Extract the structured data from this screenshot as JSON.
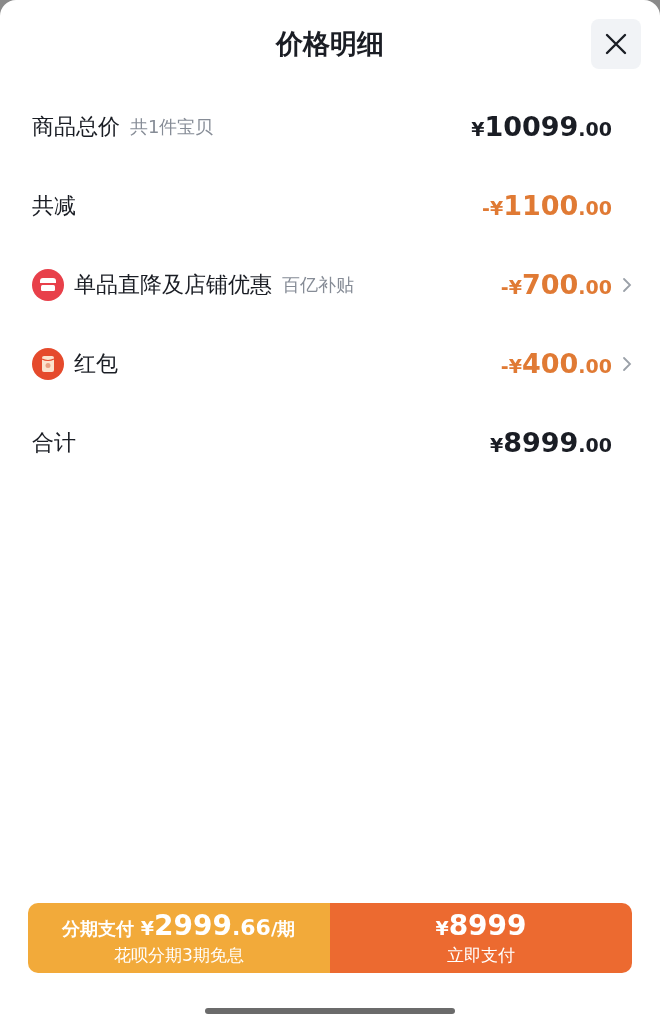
{
  "title": "价格明细",
  "rows": [
    {
      "kind": "plain",
      "label": "商品总价",
      "note": "共1件宝贝",
      "prefix": "¥",
      "integer": "10099",
      "decimal": ".00",
      "discount": false,
      "expandable": false
    },
    {
      "kind": "plain",
      "label": "共减",
      "prefix": "-¥",
      "integer": "1100",
      "decimal": ".00",
      "discount": true,
      "expandable": false
    },
    {
      "kind": "store",
      "label": "单品直降及店铺优惠",
      "note": "百亿补贴",
      "prefix": "-¥",
      "integer": "700",
      "decimal": ".00",
      "discount": true,
      "expandable": true
    },
    {
      "kind": "envelope",
      "label": "红包",
      "prefix": "-¥",
      "integer": "400",
      "decimal": ".00",
      "discount": true,
      "expandable": true
    },
    {
      "kind": "plain",
      "label": "合计",
      "prefix": "¥",
      "integer": "8999",
      "decimal": ".00",
      "discount": false,
      "expandable": false
    }
  ],
  "installment_button": {
    "label": "分期支付",
    "prefix": "¥",
    "integer": "2999",
    "decimal": ".66",
    "unit": "/期",
    "subtitle": "花呗分期3期免息"
  },
  "pay_button": {
    "prefix": "¥",
    "integer": "8999",
    "label": "立即支付"
  }
}
